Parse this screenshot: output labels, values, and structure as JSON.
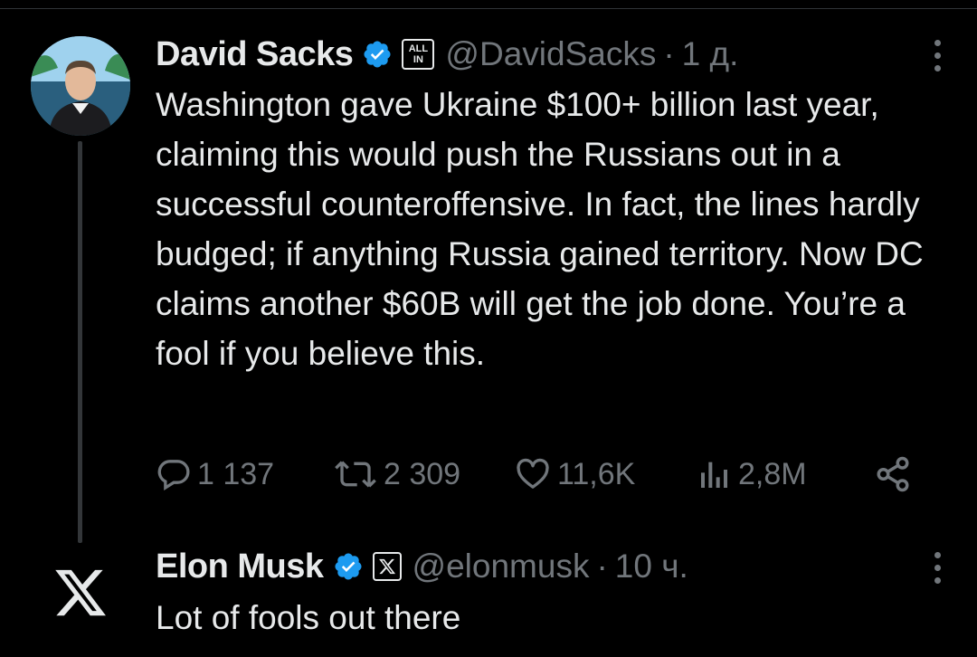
{
  "tweet1": {
    "name": "David Sacks",
    "affiliate_badge_text_1": "ALL",
    "affiliate_badge_text_2": "IN",
    "handle": "@DavidSacks",
    "separator": "·",
    "time": "1 д.",
    "text": "Washington gave Ukraine $100+ billion last year, claiming this would push the Russians out in a successful counteroffensive. In fact, the lines hardly budged; if anything Russia gained territory. Now DC claims another $60B will get the job done. You’re a fool if you believe this.",
    "replies": "1 137",
    "reposts": "2 309",
    "likes": "11,6K",
    "views": "2,8M"
  },
  "tweet2": {
    "name": "Elon Musk",
    "handle": "@elonmusk",
    "separator": "·",
    "time": "10 ч.",
    "text": "Lot of fools out there"
  },
  "colors": {
    "background": "#000000",
    "text_primary": "#e7e9ea",
    "text_secondary": "#71767b",
    "verified_blue": "#1d9bf0"
  },
  "icons": [
    "verified-badge-icon",
    "more-icon",
    "reply-icon",
    "repost-icon",
    "like-icon",
    "views-icon",
    "share-icon",
    "x-logo-icon"
  ]
}
